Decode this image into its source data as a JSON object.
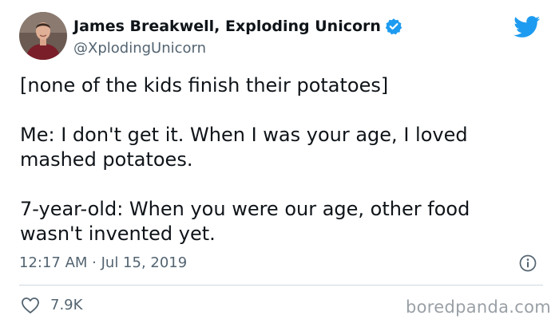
{
  "author": {
    "display_name": "James Breakwell, Exploding Unicorn",
    "handle": "@XplodingUnicorn",
    "verified": true
  },
  "tweet": {
    "paragraphs": [
      "[none of the kids finish their potatoes]",
      "Me: I don't get it. When I was your age, I loved\nmashed potatoes.",
      "7-year-old: When you were our age, other food\nwasn't invented yet."
    ],
    "timestamp": "12:17 AM · Jul 15, 2019",
    "like_count": "7.9K"
  },
  "watermark": "boredpanda.com",
  "icons": {
    "brand": "twitter-bird-icon",
    "verified": "verified-badge-icon",
    "info": "info-icon",
    "like": "heart-icon"
  },
  "colors": {
    "brand_blue": "#1d9bf0",
    "text_primary": "#0f1419",
    "text_secondary": "#536471",
    "watermark": "#9aa0a6"
  }
}
